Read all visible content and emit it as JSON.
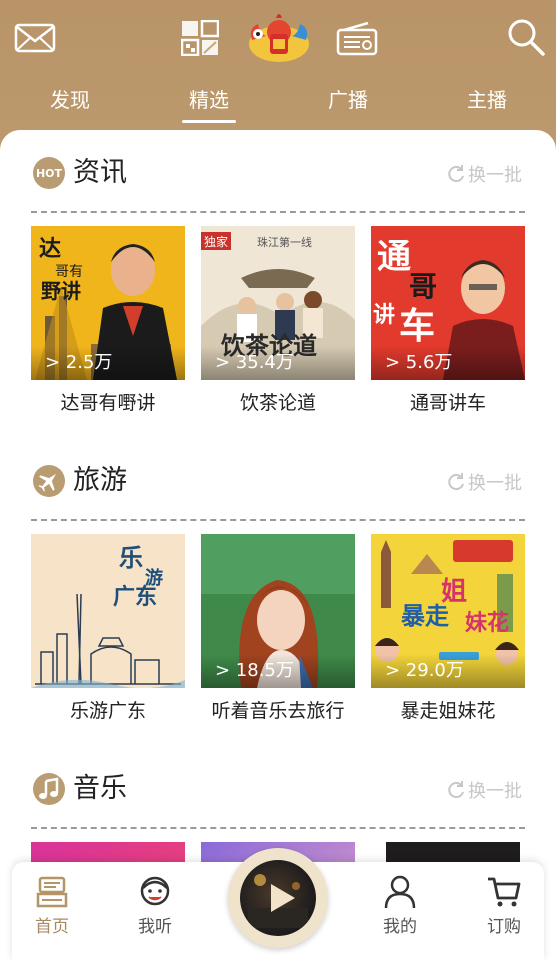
{
  "header": {
    "tabs": [
      {
        "label": "发现"
      },
      {
        "label": "精选"
      },
      {
        "label": "广播"
      },
      {
        "label": "主播"
      }
    ],
    "active_tab": "精选"
  },
  "sections": [
    {
      "title": "资讯",
      "icon": "hot-badge-icon",
      "icon_text": "HOT",
      "refresh_label": "换一批",
      "items": [
        {
          "title": "达哥有嘢讲",
          "plays": "> 2.5万"
        },
        {
          "title": "饮茶论道",
          "plays": "> 35.4万"
        },
        {
          "title": "通哥讲车",
          "plays": "> 5.6万"
        }
      ]
    },
    {
      "title": "旅游",
      "icon": "airplane-icon",
      "refresh_label": "换一批",
      "items": [
        {
          "title": "乐游广东",
          "plays": ""
        },
        {
          "title": "听着音乐去旅行",
          "plays": "> 18.5万"
        },
        {
          "title": "暴走姐妹花",
          "plays": "> 29.0万"
        }
      ]
    },
    {
      "title": "音乐",
      "icon": "music-note-icon",
      "refresh_label": "换一批",
      "items": []
    }
  ],
  "bottom_nav": [
    {
      "label": "首页",
      "icon": "home-radio-icon",
      "active": true
    },
    {
      "label": "我听",
      "icon": "listen-face-icon",
      "active": false
    },
    {
      "label": "我的",
      "icon": "user-icon",
      "active": false
    },
    {
      "label": "订购",
      "icon": "cart-icon",
      "active": false
    }
  ],
  "colors": {
    "header_gradient_top": "#b89468",
    "accent": "#a58a63",
    "section_icon": "#b99c71"
  }
}
